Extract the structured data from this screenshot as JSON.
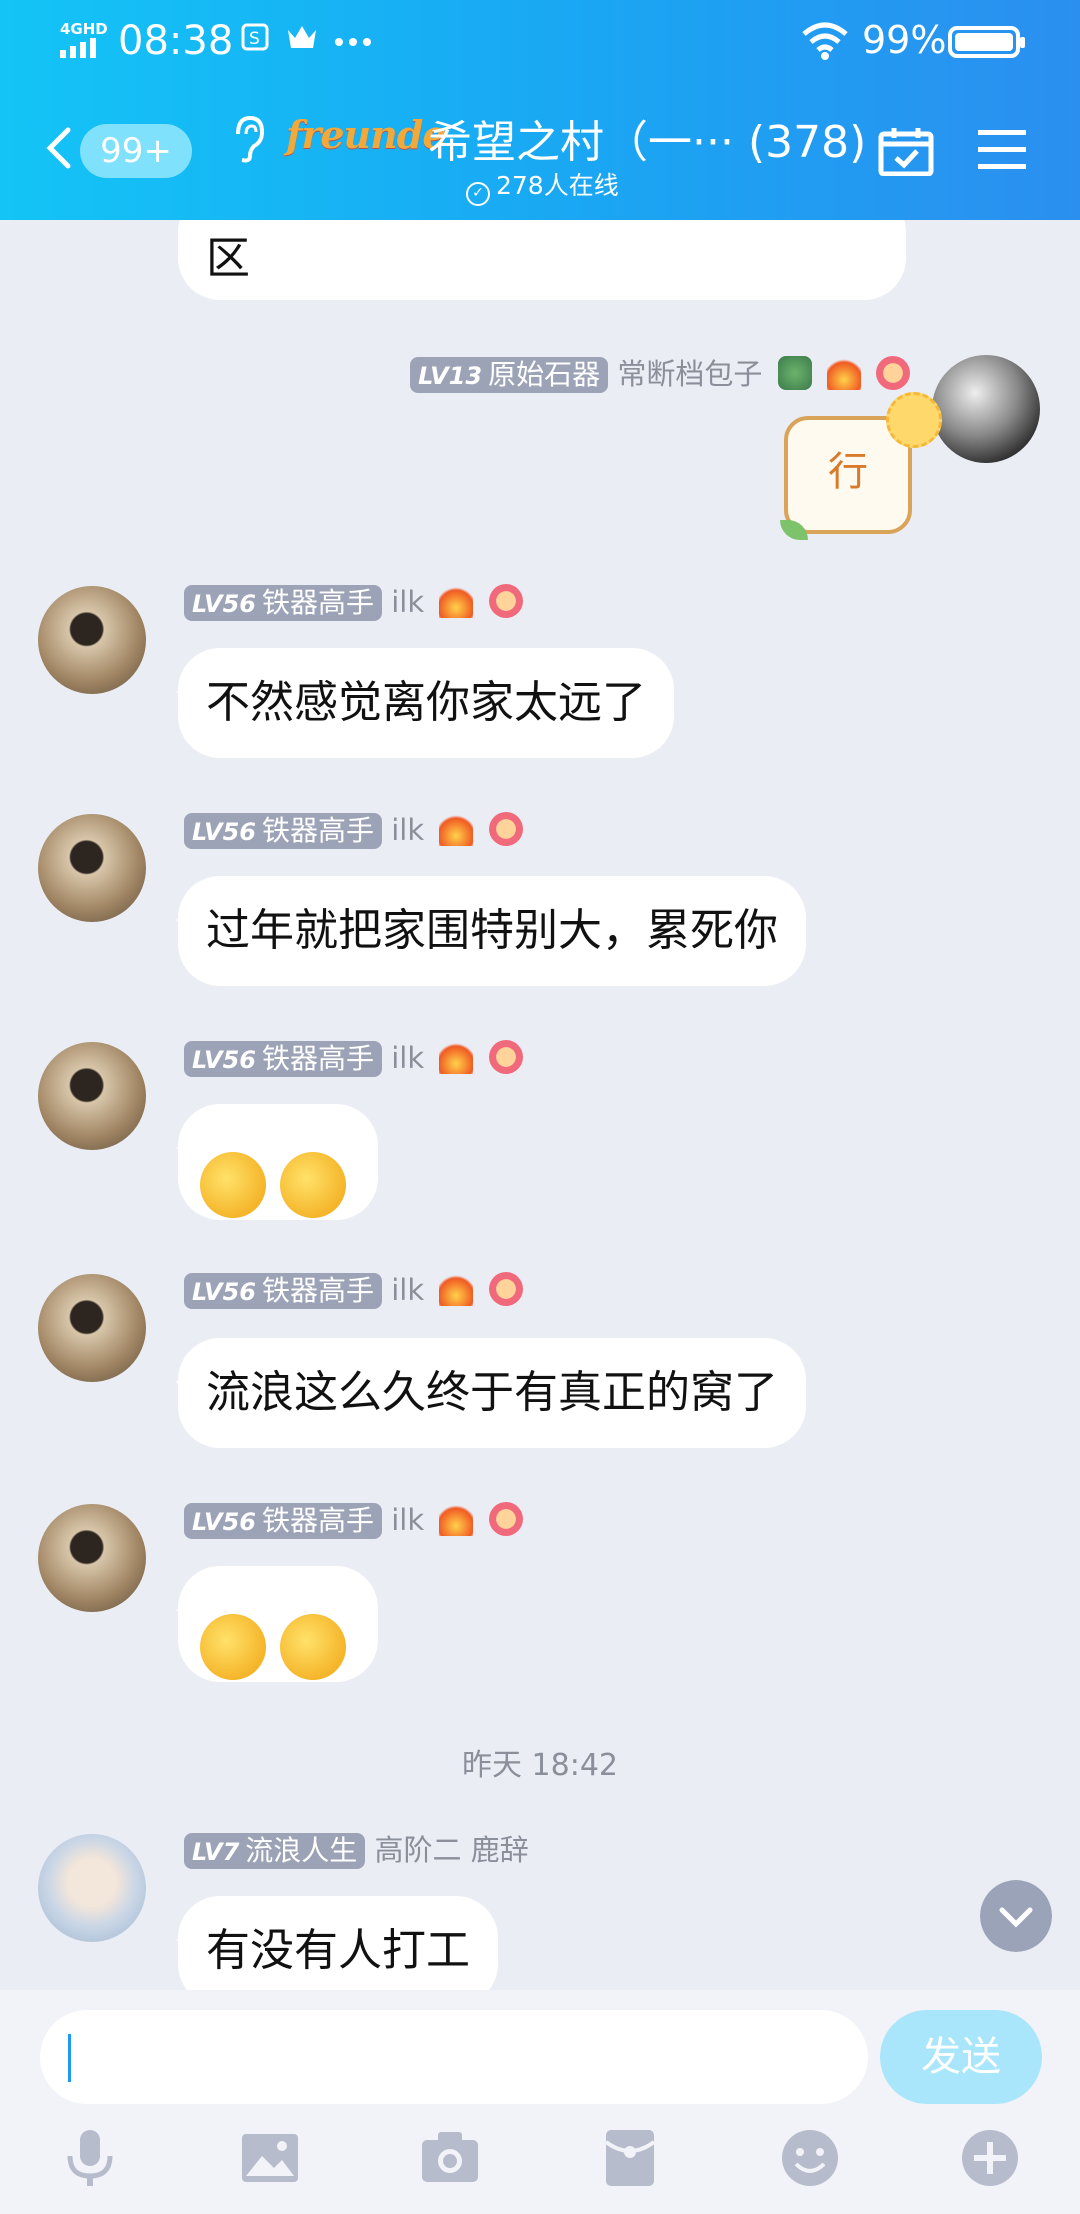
{
  "status_bar": {
    "network": "4GHD",
    "time": "08:38",
    "battery": "99%"
  },
  "header": {
    "unread_badge": "99+",
    "group_logo_text": "freunde",
    "title": "希望之村（一··· (378)",
    "online": "278人在线"
  },
  "messages": [
    {
      "text": "区"
    },
    {
      "level": "LV13",
      "title": "原始石器",
      "name": "常断档包子",
      "sticker": "行"
    },
    {
      "level": "LV56",
      "title": "铁器高手",
      "name": "ilk",
      "text": "不然感觉离你家太远了"
    },
    {
      "level": "LV56",
      "title": "铁器高手",
      "name": "ilk",
      "text": "过年就把家围特别大，累死你"
    },
    {
      "level": "LV56",
      "title": "铁器高手",
      "name": "ilk",
      "emoji": "duck-emoji x2"
    },
    {
      "level": "LV56",
      "title": "铁器高手",
      "name": "ilk",
      "text": "流浪这么久终于有真正的窝了"
    },
    {
      "level": "LV56",
      "title": "铁器高手",
      "name": "ilk",
      "emoji": "duck-emoji x2"
    },
    {
      "level": "LV7",
      "title": "流浪人生",
      "name": "高阶二 鹿辞",
      "text": "有没有人打工"
    }
  ],
  "timestamp": "昨天 18:42",
  "input": {
    "value": "",
    "send_label": "发送"
  },
  "toolbar": [
    "microphone-icon",
    "image-icon",
    "camera-icon",
    "red-packet-icon",
    "emoji-icon",
    "plus-icon"
  ]
}
